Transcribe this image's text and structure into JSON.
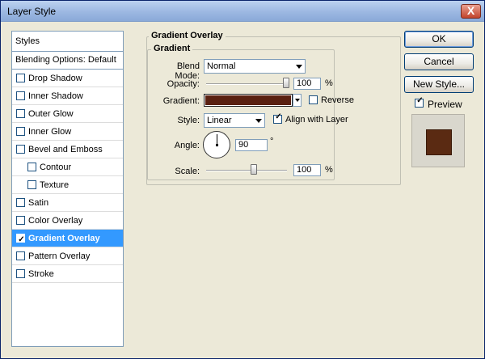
{
  "window": {
    "title": "Layer Style",
    "close_label": "X"
  },
  "sidebar": {
    "header": "Styles",
    "blending": "Blending Options: Default",
    "items": [
      {
        "label": "Drop Shadow",
        "checked": false,
        "sub": false,
        "selected": false
      },
      {
        "label": "Inner Shadow",
        "checked": false,
        "sub": false,
        "selected": false
      },
      {
        "label": "Outer Glow",
        "checked": false,
        "sub": false,
        "selected": false
      },
      {
        "label": "Inner Glow",
        "checked": false,
        "sub": false,
        "selected": false
      },
      {
        "label": "Bevel and Emboss",
        "checked": false,
        "sub": false,
        "selected": false
      },
      {
        "label": "Contour",
        "checked": false,
        "sub": true,
        "selected": false
      },
      {
        "label": "Texture",
        "checked": false,
        "sub": true,
        "selected": false
      },
      {
        "label": "Satin",
        "checked": false,
        "sub": false,
        "selected": false
      },
      {
        "label": "Color Overlay",
        "checked": false,
        "sub": false,
        "selected": false
      },
      {
        "label": "Gradient Overlay",
        "checked": true,
        "sub": false,
        "selected": true
      },
      {
        "label": "Pattern Overlay",
        "checked": false,
        "sub": false,
        "selected": false
      },
      {
        "label": "Stroke",
        "checked": false,
        "sub": false,
        "selected": false
      }
    ]
  },
  "panel": {
    "outer_title": "Gradient Overlay",
    "inner_title": "Gradient",
    "blend_mode_label": "Blend Mode:",
    "blend_mode_value": "Normal",
    "opacity_label": "Opacity:",
    "opacity_value": "100",
    "opacity_level": 1.0,
    "percent": "%",
    "gradient_label": "Gradient:",
    "gradient_color": "#5a2010",
    "reverse_label": "Reverse",
    "reverse_checked": false,
    "style_label": "Style:",
    "style_value": "Linear",
    "align_label": "Align with Layer",
    "align_checked": true,
    "angle_label": "Angle:",
    "angle_value": "90",
    "degree": "°",
    "scale_label": "Scale:",
    "scale_value": "100",
    "scale_level": 0.6
  },
  "buttons": {
    "ok": "OK",
    "cancel": "Cancel",
    "new_style": "New Style..."
  },
  "preview": {
    "label": "Preview",
    "checked": true,
    "color": "#5a2a12"
  },
  "icons": {
    "check": "✓"
  }
}
